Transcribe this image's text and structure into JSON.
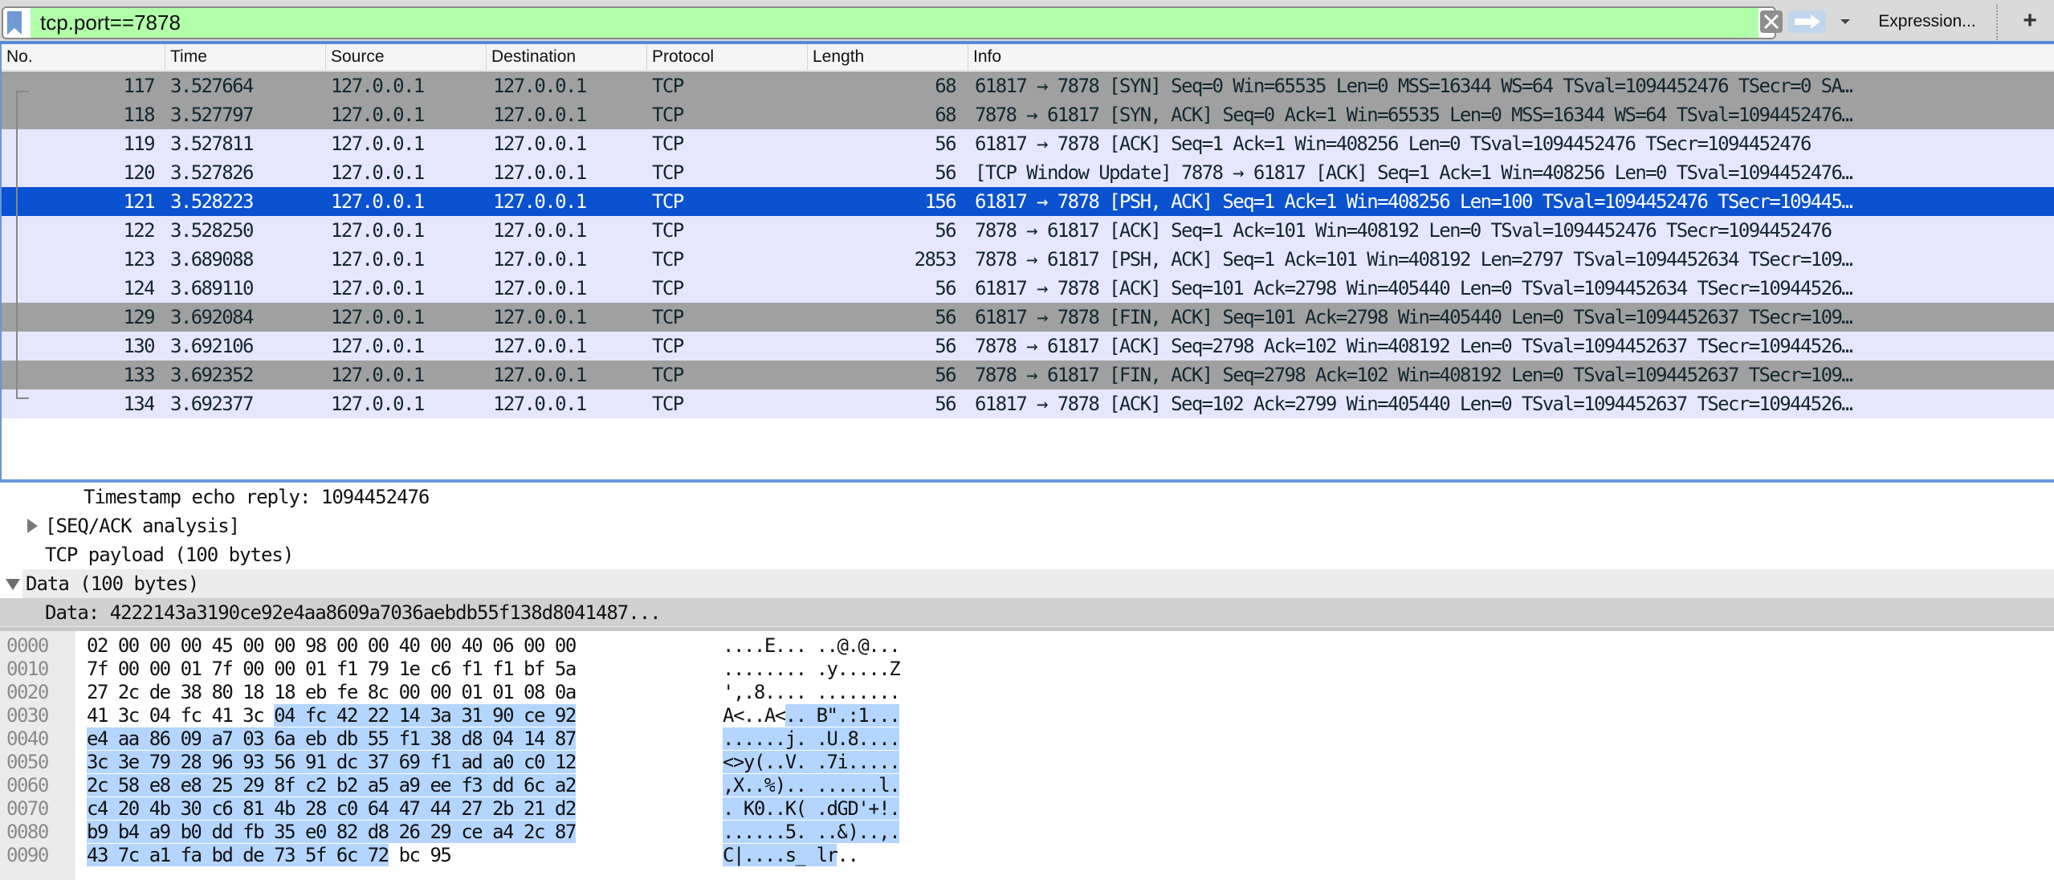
{
  "toolbar": {
    "filter_value": "tcp.port==7878",
    "clear_icon": "clear-x-icon",
    "apply_icon": "arrow-right-icon",
    "history_icon": "dropdown-triangle-icon",
    "expression_label": "Expression...",
    "add_label": "+",
    "filter_color": "#b2ffaa"
  },
  "packet_list": {
    "columns": [
      "No.",
      "Time",
      "Source",
      "Destination",
      "Protocol",
      "Length",
      "Info"
    ],
    "selected_no": "121",
    "rows": [
      {
        "no": "117",
        "time": "3.527664",
        "src": "127.0.0.1",
        "dst": "127.0.0.1",
        "proto": "TCP",
        "len": "68",
        "info": "61817 → 7878 [SYN] Seq=0 Win=65535 Len=0 MSS=16344 WS=64 TSval=1094452476 TSecr=0 SA…",
        "style": "gray"
      },
      {
        "no": "118",
        "time": "3.527797",
        "src": "127.0.0.1",
        "dst": "127.0.0.1",
        "proto": "TCP",
        "len": "68",
        "info": "7878 → 61817 [SYN, ACK] Seq=0 Ack=1 Win=65535 Len=0 MSS=16344 WS=64 TSval=1094452476…",
        "style": "gray"
      },
      {
        "no": "119",
        "time": "3.527811",
        "src": "127.0.0.1",
        "dst": "127.0.0.1",
        "proto": "TCP",
        "len": "56",
        "info": "61817 → 7878 [ACK] Seq=1 Ack=1 Win=408256 Len=0 TSval=1094452476 TSecr=1094452476",
        "style": "light"
      },
      {
        "no": "120",
        "time": "3.527826",
        "src": "127.0.0.1",
        "dst": "127.0.0.1",
        "proto": "TCP",
        "len": "56",
        "info": "[TCP Window Update] 7878 → 61817 [ACK] Seq=1 Ack=1 Win=408256 Len=0 TSval=1094452476…",
        "style": "light"
      },
      {
        "no": "121",
        "time": "3.528223",
        "src": "127.0.0.1",
        "dst": "127.0.0.1",
        "proto": "TCP",
        "len": "156",
        "info": "61817 → 7878 [PSH, ACK] Seq=1 Ack=1 Win=408256 Len=100 TSval=1094452476 TSecr=109445…",
        "style": "sel"
      },
      {
        "no": "122",
        "time": "3.528250",
        "src": "127.0.0.1",
        "dst": "127.0.0.1",
        "proto": "TCP",
        "len": "56",
        "info": "7878 → 61817 [ACK] Seq=1 Ack=101 Win=408192 Len=0 TSval=1094452476 TSecr=1094452476",
        "style": "light"
      },
      {
        "no": "123",
        "time": "3.689088",
        "src": "127.0.0.1",
        "dst": "127.0.0.1",
        "proto": "TCP",
        "len": "2853",
        "info": "7878 → 61817 [PSH, ACK] Seq=1 Ack=101 Win=408192 Len=2797 TSval=1094452634 TSecr=109…",
        "style": "light"
      },
      {
        "no": "124",
        "time": "3.689110",
        "src": "127.0.0.1",
        "dst": "127.0.0.1",
        "proto": "TCP",
        "len": "56",
        "info": "61817 → 7878 [ACK] Seq=101 Ack=2798 Win=405440 Len=0 TSval=1094452634 TSecr=10944526…",
        "style": "light"
      },
      {
        "no": "129",
        "time": "3.692084",
        "src": "127.0.0.1",
        "dst": "127.0.0.1",
        "proto": "TCP",
        "len": "56",
        "info": "61817 → 7878 [FIN, ACK] Seq=101 Ack=2798 Win=405440 Len=0 TSval=1094452637 TSecr=109…",
        "style": "gray"
      },
      {
        "no": "130",
        "time": "3.692106",
        "src": "127.0.0.1",
        "dst": "127.0.0.1",
        "proto": "TCP",
        "len": "56",
        "info": "7878 → 61817 [ACK] Seq=2798 Ack=102 Win=408192 Len=0 TSval=1094452637 TSecr=10944526…",
        "style": "light"
      },
      {
        "no": "133",
        "time": "3.692352",
        "src": "127.0.0.1",
        "dst": "127.0.0.1",
        "proto": "TCP",
        "len": "56",
        "info": "7878 → 61817 [FIN, ACK] Seq=2798 Ack=102 Win=408192 Len=0 TSval=1094452637 TSecr=109…",
        "style": "gray"
      },
      {
        "no": "134",
        "time": "3.692377",
        "src": "127.0.0.1",
        "dst": "127.0.0.1",
        "proto": "TCP",
        "len": "56",
        "info": "61817 → 7878 [ACK] Seq=102 Ack=2799 Win=405440 Len=0 TSval=1094452637 TSecr=10944526…",
        "style": "light"
      }
    ],
    "colors": {
      "light": "#e7e6ff",
      "gray": "#a0a0a0",
      "selected": "#0b52d0"
    }
  },
  "details": {
    "rows": [
      {
        "text": "Timestamp echo reply: 1094452476",
        "indent": 3,
        "expander": "none"
      },
      {
        "text": "[SEQ/ACK analysis]",
        "indent": 2,
        "expander": "collapsed"
      },
      {
        "text": "TCP payload (100 bytes)",
        "indent": 2,
        "expander": "none"
      },
      {
        "text": "Data (100 bytes)",
        "indent": 1,
        "expander": "expanded"
      },
      {
        "text": "Data: 4222143a3190ce92e4aa8609a7036aebdb55f138d8041487...",
        "indent": 2,
        "expander": "none"
      }
    ]
  },
  "bytes": {
    "highlight_start": 54,
    "highlight_end": 154,
    "highlight_color": "#b4d5fe",
    "rows": [
      {
        "offset": "0000",
        "hex": [
          "02",
          "00",
          "00",
          "00",
          "45",
          "00",
          "00",
          "98",
          "00",
          "00",
          "40",
          "00",
          "40",
          "06",
          "00",
          "00"
        ],
        "ascii": "....E... ..@.@..."
      },
      {
        "offset": "0010",
        "hex": [
          "7f",
          "00",
          "00",
          "01",
          "7f",
          "00",
          "00",
          "01",
          "f1",
          "79",
          "1e",
          "c6",
          "f1",
          "f1",
          "bf",
          "5a"
        ],
        "ascii": "........ .y.....Z"
      },
      {
        "offset": "0020",
        "hex": [
          "27",
          "2c",
          "de",
          "38",
          "80",
          "18",
          "18",
          "eb",
          "fe",
          "8c",
          "00",
          "00",
          "01",
          "01",
          "08",
          "0a"
        ],
        "ascii": "',.8.... ........"
      },
      {
        "offset": "0030",
        "hex": [
          "41",
          "3c",
          "04",
          "fc",
          "41",
          "3c",
          "04",
          "fc",
          "42",
          "22",
          "14",
          "3a",
          "31",
          "90",
          "ce",
          "92"
        ],
        "ascii": "A<..A<.. B\".:1..."
      },
      {
        "offset": "0040",
        "hex": [
          "e4",
          "aa",
          "86",
          "09",
          "a7",
          "03",
          "6a",
          "eb",
          "db",
          "55",
          "f1",
          "38",
          "d8",
          "04",
          "14",
          "87"
        ],
        "ascii": "......j. .U.8...."
      },
      {
        "offset": "0050",
        "hex": [
          "3c",
          "3e",
          "79",
          "28",
          "96",
          "93",
          "56",
          "91",
          "dc",
          "37",
          "69",
          "f1",
          "ad",
          "a0",
          "c0",
          "12"
        ],
        "ascii": "<>y(..V. .7i....."
      },
      {
        "offset": "0060",
        "hex": [
          "2c",
          "58",
          "e8",
          "e8",
          "25",
          "29",
          "8f",
          "c2",
          "b2",
          "a5",
          "a9",
          "ee",
          "f3",
          "dd",
          "6c",
          "a2"
        ],
        "ascii": ",X..%).. ......l."
      },
      {
        "offset": "0070",
        "hex": [
          "c4",
          "20",
          "4b",
          "30",
          "c6",
          "81",
          "4b",
          "28",
          "c0",
          "64",
          "47",
          "44",
          "27",
          "2b",
          "21",
          "d2"
        ],
        "ascii": ". K0..K( .dGD'+!."
      },
      {
        "offset": "0080",
        "hex": [
          "b9",
          "b4",
          "a9",
          "b0",
          "dd",
          "fb",
          "35",
          "e0",
          "82",
          "d8",
          "26",
          "29",
          "ce",
          "a4",
          "2c",
          "87"
        ],
        "ascii": "......5. ..&)..,."
      },
      {
        "offset": "0090",
        "hex": [
          "43",
          "7c",
          "a1",
          "fa",
          "bd",
          "de",
          "73",
          "5f",
          "6c",
          "72",
          "bc",
          "95"
        ],
        "ascii": "C|....s_ lr.."
      }
    ]
  }
}
